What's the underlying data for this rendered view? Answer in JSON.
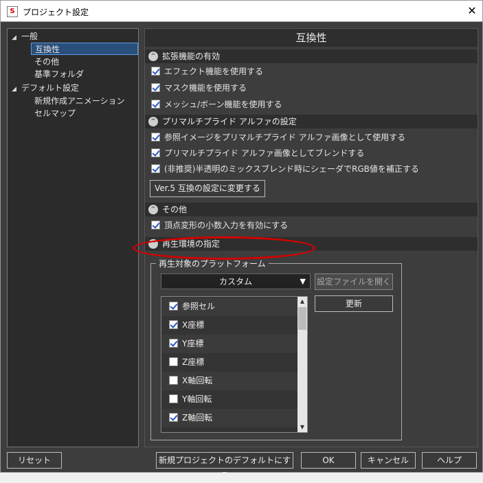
{
  "window": {
    "title": "プロジェクト設定",
    "app_icon_letter": "S",
    "close_glyph": "✕"
  },
  "tree": {
    "items": [
      {
        "label": "一般",
        "arrow": "◢"
      },
      {
        "label": "互換性"
      },
      {
        "label": "その他"
      },
      {
        "label": "基準フォルダ"
      },
      {
        "label": "デフォルト設定",
        "arrow": "◢"
      },
      {
        "label": "新規作成アニメーション"
      },
      {
        "label": "セルマップ"
      }
    ]
  },
  "panel": {
    "title": "互換性",
    "sections": [
      {
        "label": "拡張機能の有効",
        "icon": "^"
      },
      {
        "label": "プリマルチプライド アルファの設定",
        "icon": "^"
      },
      {
        "label": "その他",
        "icon": "^"
      },
      {
        "label": "再生環境の指定",
        "icon": "^"
      }
    ],
    "checkboxes": [
      {
        "label": "エフェクト機能を使用する",
        "checked": true
      },
      {
        "label": "マスク機能を使用する",
        "checked": true
      },
      {
        "label": "メッシュ/ボーン機能を使用する",
        "checked": true
      },
      {
        "label": "参照イメージをプリマルチプライド アルファ画像として使用する",
        "checked": true
      },
      {
        "label": "プリマルチプライド アルファ画像としてブレンドする",
        "checked": true
      },
      {
        "label": "(非推奨)半透明のミックスブレンド時にシェーダでRGB値を補正する",
        "checked": true
      },
      {
        "label": "頂点変形の小数入力を有効にする",
        "checked": true
      }
    ],
    "ver5_button": "Ver.5 互換の設定に変更する",
    "platform_group_label": "再生対象のプラットフォーム",
    "platform_select": {
      "value": "カスタム",
      "arrow": "▼"
    },
    "open_settings_button": "設定ファイルを開く",
    "update_button": "更新",
    "platform_list": [
      {
        "label": "参照セル",
        "checked": true
      },
      {
        "label": "X座標",
        "checked": true
      },
      {
        "label": "Y座標",
        "checked": true
      },
      {
        "label": "Z座標",
        "checked": false
      },
      {
        "label": "X軸回転",
        "checked": false
      },
      {
        "label": "Y軸回転",
        "checked": false
      },
      {
        "label": "Z軸回転",
        "checked": true
      }
    ],
    "scroll_up": "▲",
    "scroll_down": "▼"
  },
  "footer": {
    "reset": "リセット",
    "set_default": "新規プロジェクトのデフォルトにする",
    "ok": "OK",
    "cancel": "キャンセル",
    "help": "ヘルプ"
  },
  "colors": {
    "background": "#3d3d3d",
    "highlight_ellipse": "#d40000",
    "selected_tree": "#2a4f7a"
  }
}
